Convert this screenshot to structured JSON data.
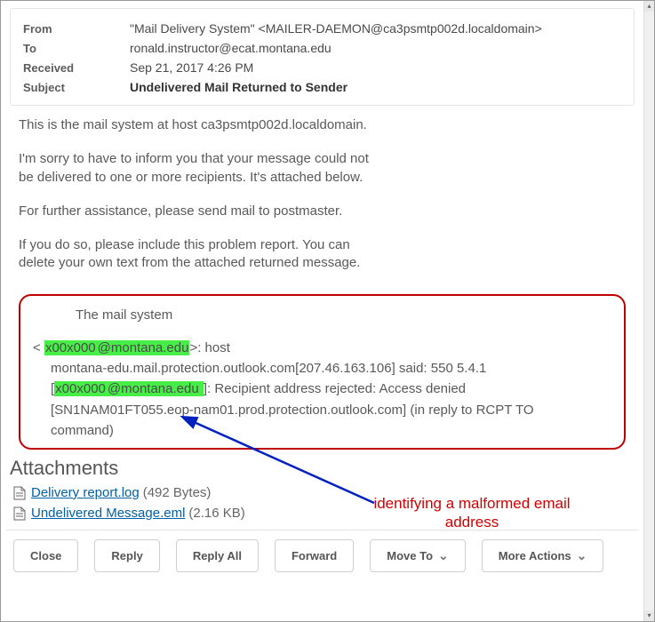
{
  "headers": {
    "from_label": "From",
    "from_value": "\"Mail Delivery System\" <MAILER-DAEMON@ca3psmtp002d.localdomain>",
    "to_label": "To",
    "to_value": "ronald.instructor@ecat.montana.edu",
    "received_label": "Received",
    "received_value": "Sep 21, 2017 4:26 PM",
    "subject_label": "Subject",
    "subject_value": "Undelivered Mail Returned to Sender"
  },
  "body": {
    "p1": "This is the mail system at host ca3psmtp002d.localdomain.",
    "p2a": "I'm sorry to have to inform you that your message could not",
    "p2b": "be delivered to one or more recipients. It's attached below.",
    "p3": "For further assistance, please send mail to postmaster.",
    "p4a": "If you do so, please include this problem report. You can",
    "p4b": "delete your own text from the attached returned message."
  },
  "callout": {
    "line1": "The mail system",
    "pre_lt": "<",
    "hl1a": "x00x000",
    "hl1b": "@montana.edu",
    "after1": ">: host",
    "l2a": "montana-edu.mail.protection.outlook.com[207.46.163.106] said: 550 5.4.1",
    "l3_open": "[",
    "hl2a": "x00x000",
    "hl2b": "@montana.edu ",
    "l3_close": "]: Recipient address rejected: Access denied",
    "l4": "[SN1NAM01FT055.eop-nam01.prod.protection.outlook.com] (in reply to RCPT TO",
    "l5": "command)"
  },
  "attachments": {
    "heading": "Attachments",
    "items": [
      {
        "name": "Delivery report.log",
        "size": "(492 Bytes)"
      },
      {
        "name": "Undelivered Message.eml",
        "size": "(2.16 KB)"
      }
    ]
  },
  "buttons": {
    "close": "Close",
    "reply": "Reply",
    "reply_all": "Reply All",
    "forward": "Forward",
    "move_to": "Move To",
    "more_actions": "More Actions"
  },
  "annotation": {
    "text_l1": "identifying a malformed email",
    "text_l2": "address"
  }
}
